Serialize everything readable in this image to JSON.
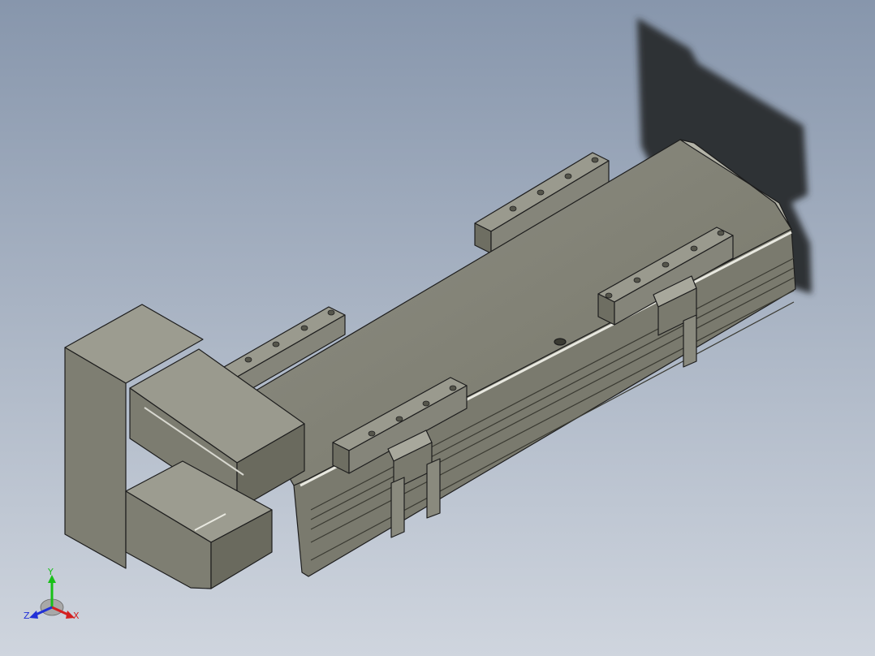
{
  "viewport": {
    "background_top": "#8796ac",
    "background_bottom": "#cfd5de"
  },
  "model": {
    "body_color": "#7c7c70",
    "edge_color": "#1d1d1d",
    "shadow_color": "#2d3136"
  },
  "triad": {
    "x_label": "X",
    "y_label": "Y",
    "z_label": "Z",
    "x_color": "#d42020",
    "y_color": "#18c018",
    "z_color": "#2030d8"
  }
}
